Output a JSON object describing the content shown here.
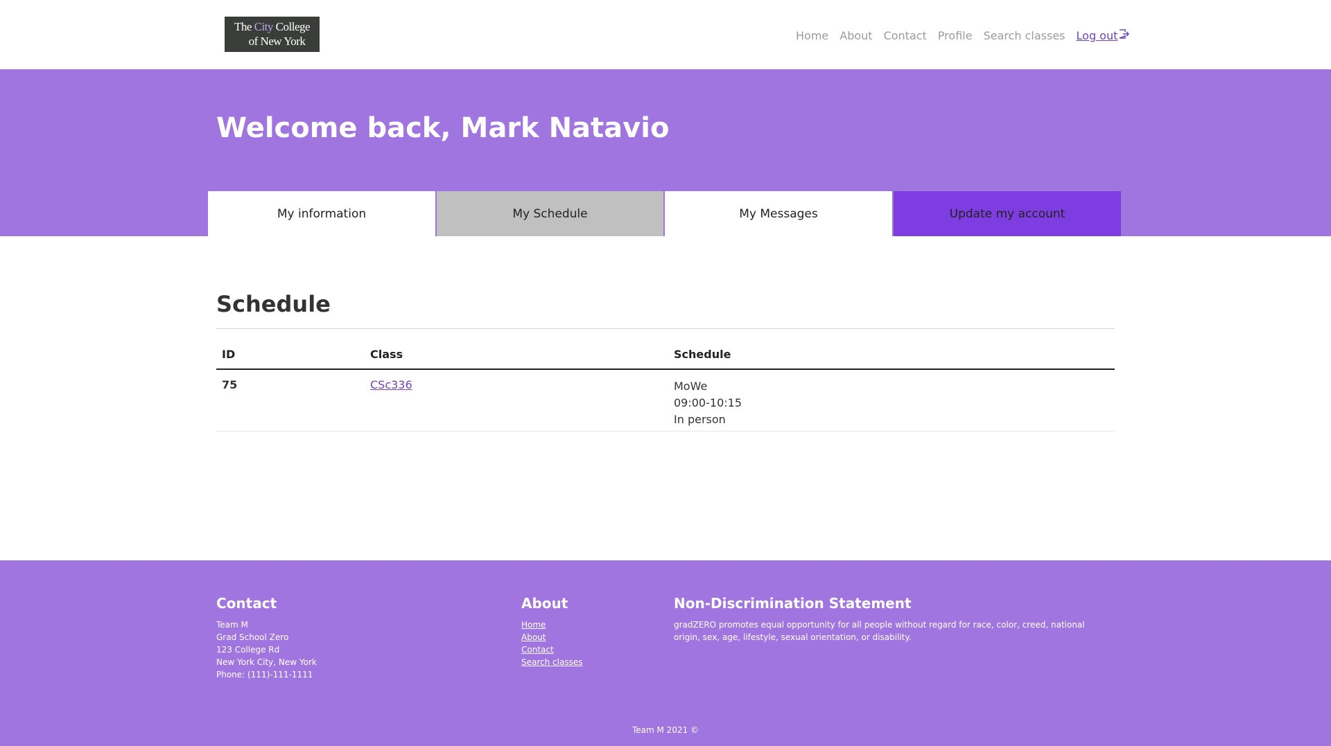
{
  "header": {
    "logo": {
      "line1_part1": "The ",
      "line1_city": "City",
      "line1_part2": " College",
      "line2": "of New York"
    },
    "nav": [
      "Home",
      "About",
      "Contact",
      "Profile",
      "Search classes"
    ],
    "logout_label": "Log out"
  },
  "hero": {
    "welcome": "Welcome back, Mark Natavio"
  },
  "tabs": [
    "My information",
    "My Schedule",
    "My Messages",
    "Update my account"
  ],
  "schedule": {
    "title": "Schedule",
    "columns": [
      "ID",
      "Class",
      "Schedule"
    ],
    "rows": [
      {
        "id": "75",
        "class": "CSc336",
        "schedule": [
          "MoWe",
          "09:00-10:15",
          "In person"
        ]
      }
    ]
  },
  "footer": {
    "contact": {
      "title": "Contact",
      "lines": [
        "Team M",
        "Grad School Zero",
        "123 College Rd",
        "New York City, New York",
        "Phone: (111)-111-1111"
      ]
    },
    "about": {
      "title": "About",
      "links": [
        "Home",
        "About",
        "Contact",
        "Search classes"
      ]
    },
    "nondiscrimination": {
      "title": "Non-Discrimination Statement",
      "text": "gradZERO promotes equal opportunity for all people without regard for race, color, creed, national origin, sex, age, lifestyle, sexual orientation, or disability."
    },
    "copyright": "Team M 2021 ©"
  },
  "colors": {
    "purple_bg": "#a075e0",
    "accent_tab": "#7d3de0",
    "link": "#6f42c1",
    "tab_active": "#c0c0c0"
  }
}
